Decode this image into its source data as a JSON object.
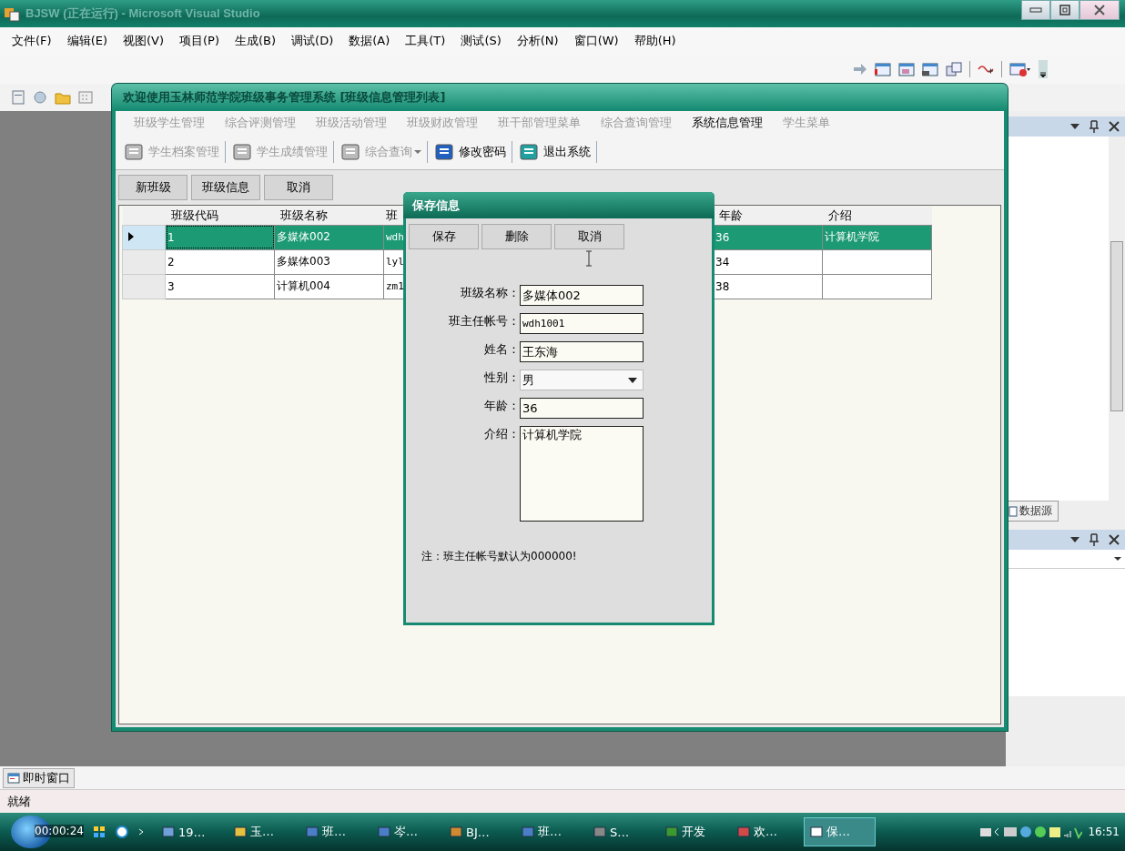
{
  "window": {
    "title": "BJSW (正在运行) - Microsoft Visual Studio"
  },
  "menu": [
    "文件(F)",
    "编辑(E)",
    "视图(V)",
    "项目(P)",
    "生成(B)",
    "调试(D)",
    "数据(A)",
    "工具(T)",
    "测试(S)",
    "分析(N)",
    "窗口(W)",
    "帮助(H)"
  ],
  "child_window": {
    "title": "欢迎使用玉林师范学院班级事务管理系统 [班级信息管理列表]",
    "menu": [
      {
        "label": "班级学生管理",
        "disabled": true
      },
      {
        "label": "综合评测管理",
        "disabled": true
      },
      {
        "label": "班级活动管理",
        "disabled": true
      },
      {
        "label": "班级财政管理",
        "disabled": true
      },
      {
        "label": "班干部管理菜单",
        "disabled": true
      },
      {
        "label": "综合查询管理",
        "disabled": true
      },
      {
        "label": "系统信息管理",
        "disabled": false
      },
      {
        "label": "学生菜单",
        "disabled": true
      }
    ],
    "toolbar": [
      {
        "kind": "button",
        "label": "学生档案管理",
        "disabled": true
      },
      {
        "kind": "button",
        "label": "学生成绩管理",
        "disabled": true
      },
      {
        "kind": "dropdown",
        "label": "综合查询",
        "disabled": true
      },
      {
        "kind": "button",
        "label": "修改密码",
        "disabled": false
      },
      {
        "kind": "button",
        "label": "退出系统",
        "disabled": false
      }
    ],
    "buttons": [
      "新班级",
      "班级信息",
      "取消"
    ],
    "grid": {
      "columns": [
        "班级代码",
        "班级名称",
        "班",
        "年龄",
        "介绍"
      ],
      "rows": [
        {
          "selected": true,
          "code": "1",
          "name": "多媒体002",
          "column_3": "wdh",
          "age": "36",
          "intro": "计算机学院"
        },
        {
          "selected": false,
          "code": "2",
          "name": "多媒体003",
          "column_3": "lyl",
          "age": "34"
        },
        {
          "selected": false,
          "code": "3",
          "name": "计算机004",
          "column_3": "zm1",
          "age": "38"
        }
      ]
    }
  },
  "dialog": {
    "title": "保存信息",
    "buttons": [
      "保存",
      "删除",
      "取消"
    ],
    "fields": [
      {
        "kind": "text",
        "label": "班级名称：",
        "value": "多媒体002"
      },
      {
        "kind": "text",
        "label": "班主任帐号：",
        "value": "wdh1001"
      },
      {
        "kind": "text",
        "label": "姓名：",
        "value": "王东海"
      },
      {
        "kind": "select",
        "label": "性别：",
        "value": "男"
      },
      {
        "kind": "text",
        "label": "年龄：",
        "value": "36"
      },
      {
        "kind": "textarea",
        "label": "介绍：",
        "value": "计算机学院"
      }
    ],
    "note": "注：班主任帐号默认为000000!"
  },
  "right_panel": {
    "tab": "数据源"
  },
  "bottom_tab": "即时窗口",
  "status": "就绪",
  "taskbar": {
    "timer": "00:00:24",
    "items": [
      {
        "label": "19…",
        "selected": false
      },
      {
        "label": "玉…",
        "selected": false
      },
      {
        "label": "班…",
        "selected": false
      },
      {
        "label": "岑…",
        "selected": false
      },
      {
        "label": "BJ…",
        "selected": false
      },
      {
        "label": "班…",
        "selected": false
      },
      {
        "label": "S…",
        "selected": false
      },
      {
        "label": "开发",
        "selected": false
      },
      {
        "label": "欢…",
        "selected": false
      },
      {
        "label": "保…",
        "selected": true
      }
    ],
    "clock": "16:51"
  }
}
